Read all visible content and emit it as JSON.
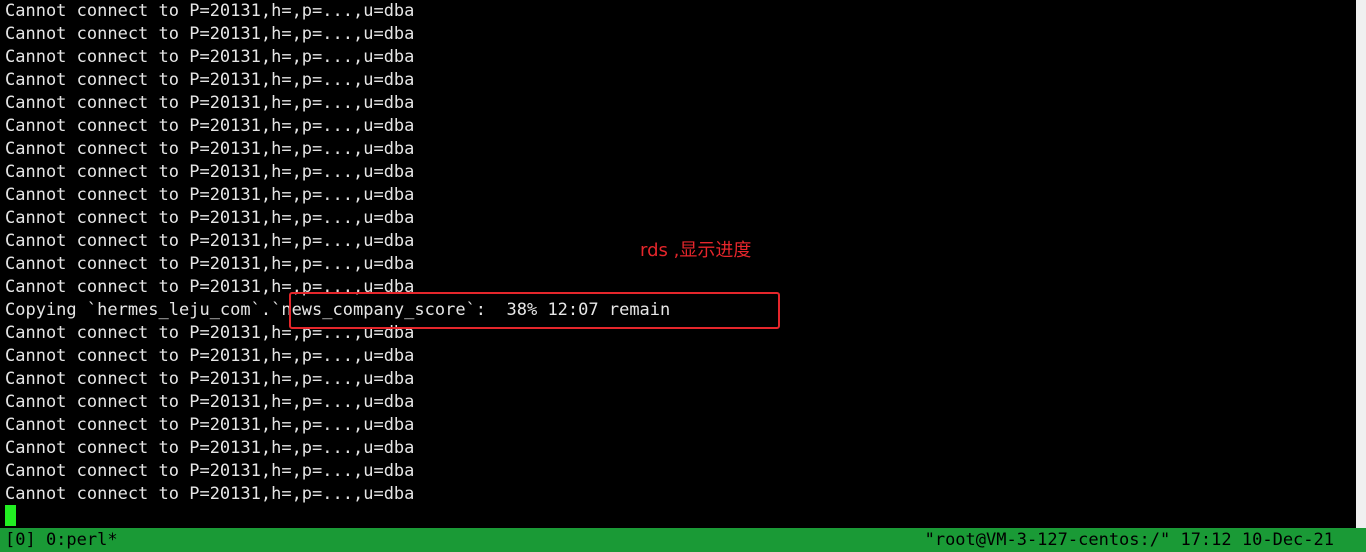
{
  "terminal": {
    "lines": [
      "Cannot connect to P=20131,h=,p=...,u=dba",
      "Cannot connect to P=20131,h=,p=...,u=dba",
      "Cannot connect to P=20131,h=,p=...,u=dba",
      "Cannot connect to P=20131,h=,p=...,u=dba",
      "Cannot connect to P=20131,h=,p=...,u=dba",
      "Cannot connect to P=20131,h=,p=...,u=dba",
      "Cannot connect to P=20131,h=,p=...,u=dba",
      "Cannot connect to P=20131,h=,p=...,u=dba",
      "Cannot connect to P=20131,h=,p=...,u=dba",
      "Cannot connect to P=20131,h=,p=...,u=dba",
      "Cannot connect to P=20131,h=,p=...,u=dba",
      "Cannot connect to P=20131,h=,p=...,u=dba",
      "Cannot connect to P=20131,h=,p=...,u=dba",
      "Copying `hermes_leju_com`.`news_company_score`:  38% 12:07 remain",
      "Cannot connect to P=20131,h=,p=...,u=dba",
      "Cannot connect to P=20131,h=,p=...,u=dba",
      "Cannot connect to P=20131,h=,p=...,u=dba",
      "Cannot connect to P=20131,h=,p=...,u=dba",
      "Cannot connect to P=20131,h=,p=...,u=dba",
      "Cannot connect to P=20131,h=,p=...,u=dba",
      "Cannot connect to P=20131,h=,p=...,u=dba",
      "Cannot connect to P=20131,h=,p=...,u=dba"
    ]
  },
  "annotation": {
    "label": "rds ,显示进度"
  },
  "statusbar": {
    "left": "[0] 0:perl*",
    "right": "\"root@VM-3-127-centos:/\" 17:12 10-Dec-21"
  },
  "colors": {
    "background": "#000000",
    "text": "#e6e6e6",
    "statusbar": "#1a9a36",
    "cursor": "#22ee22",
    "annotation": "#e5262b"
  }
}
